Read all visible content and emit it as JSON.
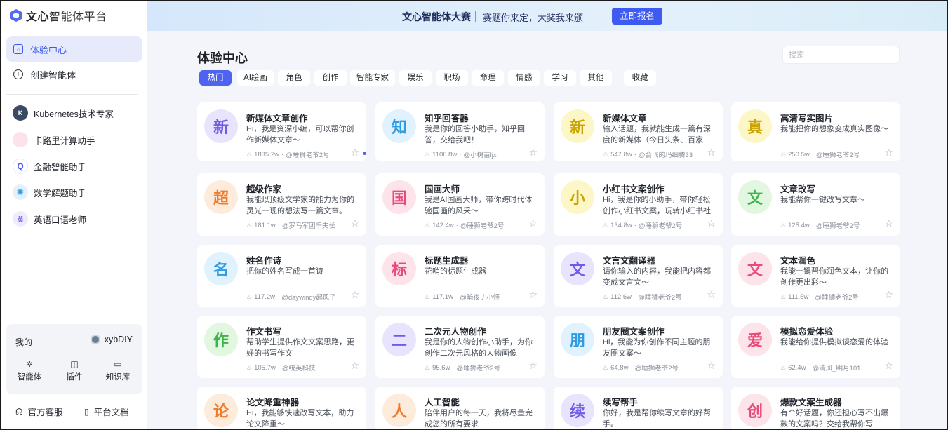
{
  "logo": {
    "brand": "文心",
    "product": "智能体平台"
  },
  "nav": [
    {
      "label": "体验中心",
      "icon": "home-icon",
      "active": true
    },
    {
      "label": "创建智能体",
      "icon": "plus-circle-icon",
      "active": false
    }
  ],
  "recent_agents": [
    {
      "label": "Kubernetes技术专家",
      "avatar_color": "#3b4a63",
      "avatar_char": "K"
    },
    {
      "label": "卡路里计算助手",
      "avatar_color": "#fde2ea",
      "avatar_char": ""
    },
    {
      "label": "金融智能助手",
      "avatar_color": "#ffffff",
      "avatar_char": "Q"
    },
    {
      "label": "数学解题助手",
      "avatar_color": "#e3f1fd",
      "avatar_char": "✺"
    },
    {
      "label": "英语口语老师",
      "avatar_color": "#efeafc",
      "avatar_char": "英"
    }
  ],
  "me": {
    "label": "我的",
    "username": "xybDIY",
    "tools": [
      {
        "label": "智能体",
        "icon": "sparkle-icon"
      },
      {
        "label": "插件",
        "icon": "plugin-icon"
      },
      {
        "label": "知识库",
        "icon": "monitor-icon"
      }
    ]
  },
  "footer": {
    "service": "官方客服",
    "docs": "平台文档"
  },
  "banner": {
    "title": "文心智能体大赛",
    "subtitle": "赛题你来定，大奖我来颁",
    "button": "立即报名"
  },
  "page": {
    "title": "体验中心",
    "search_placeholder": "搜索"
  },
  "tabs": [
    {
      "label": "热门",
      "active": true
    },
    {
      "label": "AI绘画"
    },
    {
      "label": "角色"
    },
    {
      "label": "创作"
    },
    {
      "label": "智能专家"
    },
    {
      "label": "娱乐"
    },
    {
      "label": "职场"
    },
    {
      "label": "命理"
    },
    {
      "label": "情感"
    },
    {
      "label": "学习"
    },
    {
      "label": "其他"
    },
    {
      "label": "收藏"
    }
  ],
  "cards": [
    {
      "char": "新",
      "bg": "#e8e4fd",
      "fg": "#6e5ce6",
      "title": "新媒体文章创作",
      "desc": "Hi，我是资深小编，可以帮你创作新媒体文章～",
      "count": "1835.2w",
      "author": "@睡狮老爷2号"
    },
    {
      "char": "知",
      "bg": "#dff2fd",
      "fg": "#2f9be0",
      "title": "知乎回答器",
      "desc": "我是你的回答小助手，知乎回答，交给我吧！",
      "count": "1106.8w",
      "author": "@小树苗ljx"
    },
    {
      "char": "新",
      "bg": "#fdf6c7",
      "fg": "#caa400",
      "title": "新媒体文章",
      "desc": "输入话题，我就能生成一篇有深度的新媒体（今日头条、百家号）...",
      "count": "547.8w",
      "author": "@会飞的玛细腾33"
    },
    {
      "char": "真",
      "bg": "#fdf6c7",
      "fg": "#caa400",
      "title": "高清写实图片",
      "desc": "我能把你的想象变成真实图像～",
      "count": "250.5w",
      "author": "@睡狮老爷2号"
    },
    {
      "char": "超",
      "bg": "#fdebdc",
      "fg": "#f07b2c",
      "title": "超级作家",
      "desc": "我能以顶级文学家的能力为你的灵光一现的想法写一篇文章。",
      "count": "181.1w",
      "author": "@罗马军团千夫长"
    },
    {
      "char": "国",
      "bg": "#fde3ea",
      "fg": "#e84b7a",
      "title": "国画大师",
      "desc": "我是AI国画大师，带你跨时代体验国画的风采～",
      "count": "142.4w",
      "author": "@睡狮老爷2号"
    },
    {
      "char": "小",
      "bg": "#fdf6c7",
      "fg": "#caa400",
      "title": "小红书文案创作",
      "desc": "Hi，我是你的小助手，带你轻松创作小红书文案，玩转小红书社区～",
      "count": "134.8w",
      "author": "@睡狮老爷2号"
    },
    {
      "char": "文",
      "bg": "#e1f7df",
      "fg": "#3bb54a",
      "title": "文章改写",
      "desc": "我能帮你一键改写文章～",
      "count": "125.4w",
      "author": "@睡狮老爷2号"
    },
    {
      "char": "名",
      "bg": "#dff2fd",
      "fg": "#2f9be0",
      "title": "姓名作诗",
      "desc": "把你的姓名写成一首诗",
      "count": "117.2w",
      "author": "@daywindy起风了"
    },
    {
      "char": "标",
      "bg": "#fde3ea",
      "fg": "#e84b7a",
      "title": "标题生成器",
      "desc": "花哨的标题生成器",
      "count": "117.1w",
      "author": "@暗夜丿小怪"
    },
    {
      "char": "文",
      "bg": "#e8e4fd",
      "fg": "#6e5ce6",
      "title": "文言文翻译器",
      "desc": "请你输入的内容，我能把内容都变成文言文～",
      "count": "112.6w",
      "author": "@睡狮老爷2号"
    },
    {
      "char": "文",
      "bg": "#fde3ea",
      "fg": "#e84b7a",
      "title": "文本润色",
      "desc": "我能一键帮你润色文本，让你的创作更出彩～",
      "count": "111.5w",
      "author": "@睡狮老爷2号"
    },
    {
      "char": "作",
      "bg": "#e1f7df",
      "fg": "#3bb54a",
      "title": "作文书写",
      "desc": "帮助学生提供作文文案思路，更好的书写作文",
      "count": "105.7w",
      "author": "@统英科技"
    },
    {
      "char": "二",
      "bg": "#e8e4fd",
      "fg": "#6e5ce6",
      "title": "二次元人物创作",
      "desc": "我是你的人物创作小助手，为你创作二次元风格的人物画像",
      "count": "95.6w",
      "author": "@睡狮老爷2号"
    },
    {
      "char": "朋",
      "bg": "#dff2fd",
      "fg": "#2f9be0",
      "title": "朋友圈文案创作",
      "desc": "Hi，我能为你创作不同主题的朋友圈文案～",
      "count": "64.8w",
      "author": "@睡狮老爷2号"
    },
    {
      "char": "爱",
      "bg": "#fde3ea",
      "fg": "#e84b7a",
      "title": "模拟恋爱体验",
      "desc": "我能给你提供模拟谈恋爱的体验",
      "count": "62.4w",
      "author": "@清风_明月101"
    },
    {
      "char": "论",
      "bg": "#fdebdc",
      "fg": "#f07b2c",
      "title": "论文降重神器",
      "desc": "Hi，我能够快速改写文本，助力论文降重～",
      "count": "",
      "author": ""
    },
    {
      "char": "人",
      "bg": "#fdebdc",
      "fg": "#f07b2c",
      "title": "人工智能",
      "desc": "陪伴用户的每一天，我将尽量完成您的所有要求",
      "count": "",
      "author": ""
    },
    {
      "char": "续",
      "bg": "#e8e4fd",
      "fg": "#6e5ce6",
      "title": "续写帮手",
      "desc": "你好，我是帮你续写文章的好帮手。",
      "count": "",
      "author": ""
    },
    {
      "char": "创",
      "bg": "#fde3ea",
      "fg": "#e84b7a",
      "title": "爆款文案生成器",
      "desc": "有个好话题，你还担心写不出爆款的文案吗？交给我帮你写",
      "count": "",
      "author": ""
    }
  ]
}
